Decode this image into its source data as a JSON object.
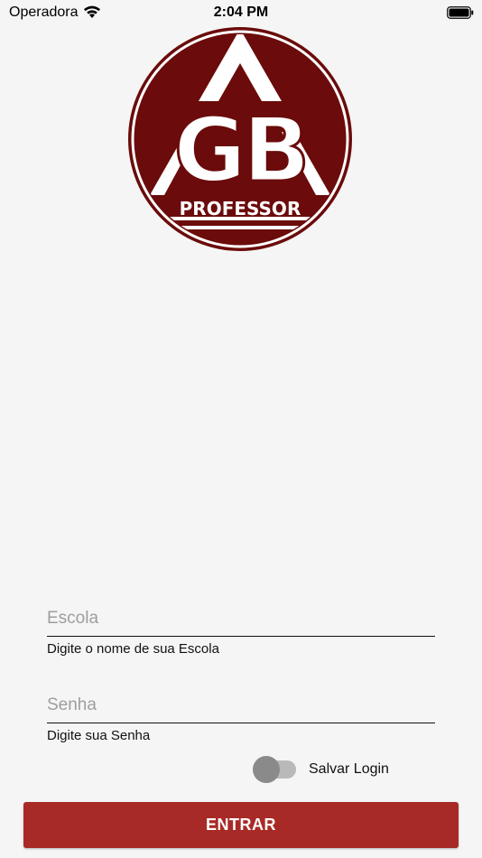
{
  "status_bar": {
    "carrier": "Operadora",
    "time": "2:04 PM",
    "wifi_icon": "wifi-icon",
    "battery_icon": "battery-icon"
  },
  "logo": {
    "letters": "GB",
    "caption": "PROFESSOR",
    "color": "#6b0b0b"
  },
  "form": {
    "school": {
      "placeholder": "Escola",
      "value": "",
      "hint": "Digite o nome de sua Escola"
    },
    "password": {
      "placeholder": "Senha",
      "value": "",
      "hint": "Digite sua Senha"
    },
    "save_login": {
      "label": "Salvar Login",
      "checked": false
    },
    "submit_label": "ENTRAR"
  },
  "colors": {
    "button": "#a82a26",
    "background": "#f5f5f5"
  }
}
